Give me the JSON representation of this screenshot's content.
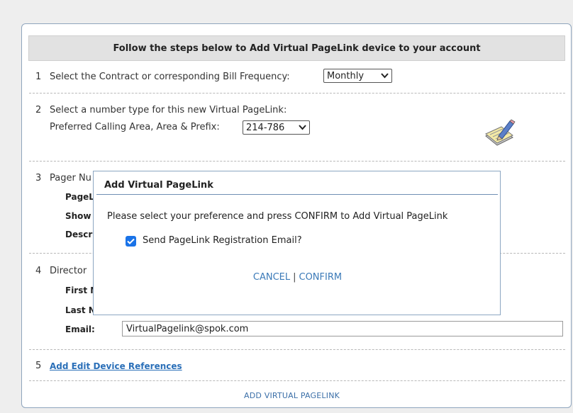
{
  "header": {
    "title": "Follow the steps below to Add Virtual PageLink device to your account"
  },
  "step1": {
    "num": "1",
    "label": "Select the Contract or corresponding Bill Frequency:",
    "select_value": "Monthly"
  },
  "step2": {
    "num": "2",
    "label": "Select a number type for this new Virtual PageLink:",
    "sub_label": "Preferred Calling Area, Area & Prefix:",
    "select_value": "214-786"
  },
  "step3": {
    "num": "3",
    "label_partial": "Pager Nu",
    "pagel_partial": "PageL",
    "show_partial": "Show",
    "descr_partial": "Descri"
  },
  "step4": {
    "num": "4",
    "label_partial": "Director",
    "first_partial": "First N",
    "last_partial": "Last N",
    "email_label": "Email:",
    "email_value": "VirtualPagelink@spok.com"
  },
  "step5": {
    "num": "5",
    "link": "Add Edit Device References"
  },
  "footer": {
    "add_link": "ADD VIRTUAL PAGELINK"
  },
  "modal": {
    "title": "Add Virtual PageLink",
    "message": "Please select your preference and press CONFIRM to Add Virtual PageLink",
    "checkbox_label": "Send PageLink Registration Email?",
    "checkbox_checked": true,
    "cancel": "CANCEL",
    "separator": "|",
    "confirm": "CONFIRM"
  },
  "icons": {
    "edit": "notepad-pencil-icon",
    "dropdown": "chevron-down-icon",
    "check": "checkmark-icon"
  },
  "colors": {
    "accent": "#1a73e8",
    "link": "#2a6fb8",
    "panel_border": "#8fa5bd"
  }
}
